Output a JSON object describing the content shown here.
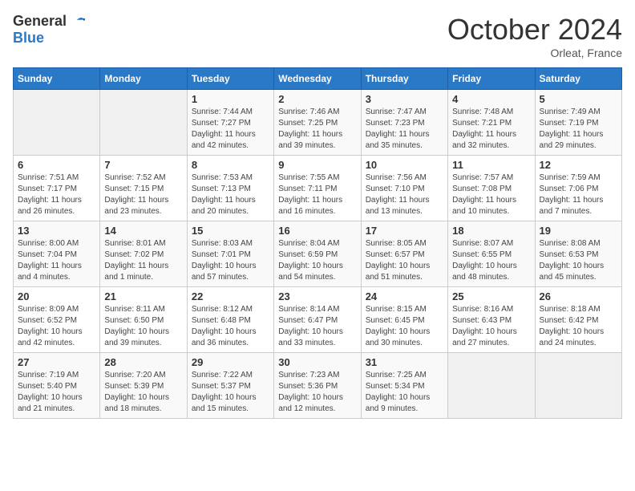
{
  "header": {
    "logo_general": "General",
    "logo_blue": "Blue",
    "month_title": "October 2024",
    "location": "Orleat, France"
  },
  "weekdays": [
    "Sunday",
    "Monday",
    "Tuesday",
    "Wednesday",
    "Thursday",
    "Friday",
    "Saturday"
  ],
  "weeks": [
    [
      {
        "day": "",
        "info": ""
      },
      {
        "day": "",
        "info": ""
      },
      {
        "day": "1",
        "info": "Sunrise: 7:44 AM\nSunset: 7:27 PM\nDaylight: 11 hours and 42 minutes."
      },
      {
        "day": "2",
        "info": "Sunrise: 7:46 AM\nSunset: 7:25 PM\nDaylight: 11 hours and 39 minutes."
      },
      {
        "day": "3",
        "info": "Sunrise: 7:47 AM\nSunset: 7:23 PM\nDaylight: 11 hours and 35 minutes."
      },
      {
        "day": "4",
        "info": "Sunrise: 7:48 AM\nSunset: 7:21 PM\nDaylight: 11 hours and 32 minutes."
      },
      {
        "day": "5",
        "info": "Sunrise: 7:49 AM\nSunset: 7:19 PM\nDaylight: 11 hours and 29 minutes."
      }
    ],
    [
      {
        "day": "6",
        "info": "Sunrise: 7:51 AM\nSunset: 7:17 PM\nDaylight: 11 hours and 26 minutes."
      },
      {
        "day": "7",
        "info": "Sunrise: 7:52 AM\nSunset: 7:15 PM\nDaylight: 11 hours and 23 minutes."
      },
      {
        "day": "8",
        "info": "Sunrise: 7:53 AM\nSunset: 7:13 PM\nDaylight: 11 hours and 20 minutes."
      },
      {
        "day": "9",
        "info": "Sunrise: 7:55 AM\nSunset: 7:11 PM\nDaylight: 11 hours and 16 minutes."
      },
      {
        "day": "10",
        "info": "Sunrise: 7:56 AM\nSunset: 7:10 PM\nDaylight: 11 hours and 13 minutes."
      },
      {
        "day": "11",
        "info": "Sunrise: 7:57 AM\nSunset: 7:08 PM\nDaylight: 11 hours and 10 minutes."
      },
      {
        "day": "12",
        "info": "Sunrise: 7:59 AM\nSunset: 7:06 PM\nDaylight: 11 hours and 7 minutes."
      }
    ],
    [
      {
        "day": "13",
        "info": "Sunrise: 8:00 AM\nSunset: 7:04 PM\nDaylight: 11 hours and 4 minutes."
      },
      {
        "day": "14",
        "info": "Sunrise: 8:01 AM\nSunset: 7:02 PM\nDaylight: 11 hours and 1 minute."
      },
      {
        "day": "15",
        "info": "Sunrise: 8:03 AM\nSunset: 7:01 PM\nDaylight: 10 hours and 57 minutes."
      },
      {
        "day": "16",
        "info": "Sunrise: 8:04 AM\nSunset: 6:59 PM\nDaylight: 10 hours and 54 minutes."
      },
      {
        "day": "17",
        "info": "Sunrise: 8:05 AM\nSunset: 6:57 PM\nDaylight: 10 hours and 51 minutes."
      },
      {
        "day": "18",
        "info": "Sunrise: 8:07 AM\nSunset: 6:55 PM\nDaylight: 10 hours and 48 minutes."
      },
      {
        "day": "19",
        "info": "Sunrise: 8:08 AM\nSunset: 6:53 PM\nDaylight: 10 hours and 45 minutes."
      }
    ],
    [
      {
        "day": "20",
        "info": "Sunrise: 8:09 AM\nSunset: 6:52 PM\nDaylight: 10 hours and 42 minutes."
      },
      {
        "day": "21",
        "info": "Sunrise: 8:11 AM\nSunset: 6:50 PM\nDaylight: 10 hours and 39 minutes."
      },
      {
        "day": "22",
        "info": "Sunrise: 8:12 AM\nSunset: 6:48 PM\nDaylight: 10 hours and 36 minutes."
      },
      {
        "day": "23",
        "info": "Sunrise: 8:14 AM\nSunset: 6:47 PM\nDaylight: 10 hours and 33 minutes."
      },
      {
        "day": "24",
        "info": "Sunrise: 8:15 AM\nSunset: 6:45 PM\nDaylight: 10 hours and 30 minutes."
      },
      {
        "day": "25",
        "info": "Sunrise: 8:16 AM\nSunset: 6:43 PM\nDaylight: 10 hours and 27 minutes."
      },
      {
        "day": "26",
        "info": "Sunrise: 8:18 AM\nSunset: 6:42 PM\nDaylight: 10 hours and 24 minutes."
      }
    ],
    [
      {
        "day": "27",
        "info": "Sunrise: 7:19 AM\nSunset: 5:40 PM\nDaylight: 10 hours and 21 minutes."
      },
      {
        "day": "28",
        "info": "Sunrise: 7:20 AM\nSunset: 5:39 PM\nDaylight: 10 hours and 18 minutes."
      },
      {
        "day": "29",
        "info": "Sunrise: 7:22 AM\nSunset: 5:37 PM\nDaylight: 10 hours and 15 minutes."
      },
      {
        "day": "30",
        "info": "Sunrise: 7:23 AM\nSunset: 5:36 PM\nDaylight: 10 hours and 12 minutes."
      },
      {
        "day": "31",
        "info": "Sunrise: 7:25 AM\nSunset: 5:34 PM\nDaylight: 10 hours and 9 minutes."
      },
      {
        "day": "",
        "info": ""
      },
      {
        "day": "",
        "info": ""
      }
    ]
  ]
}
